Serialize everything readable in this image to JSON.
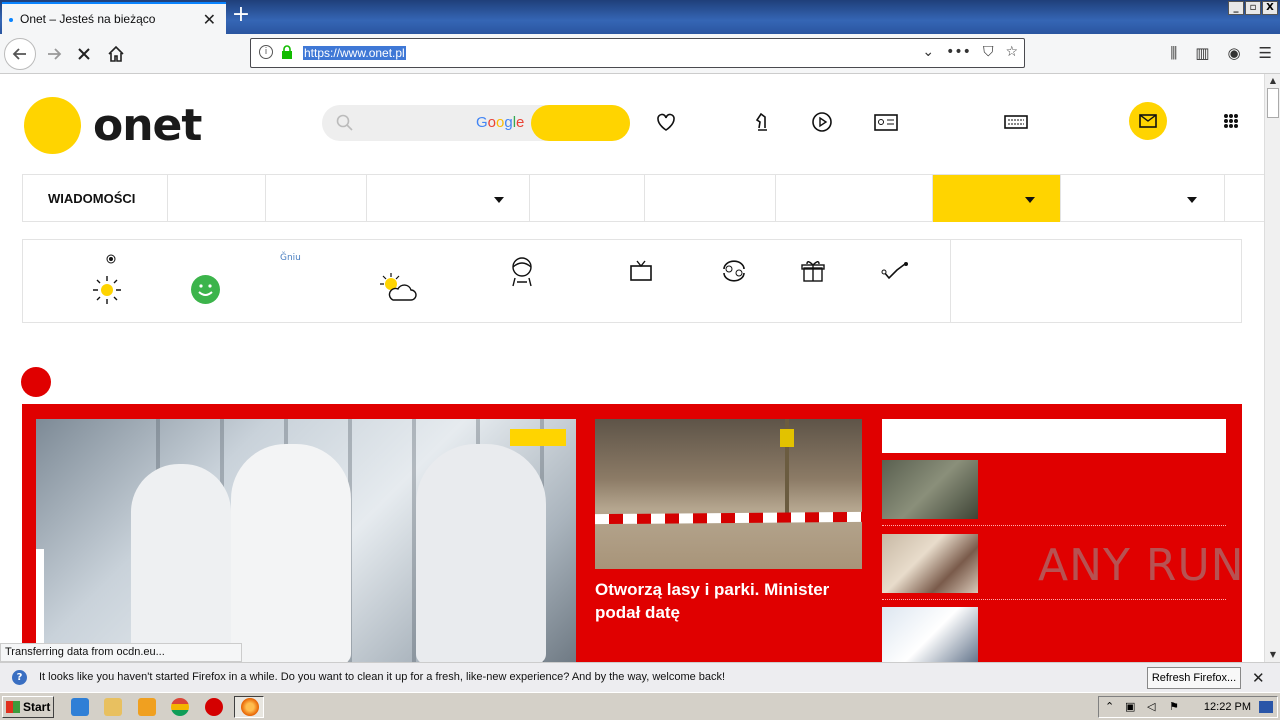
{
  "browser": {
    "tab_title": "Onet – Jesteś na bieżąco",
    "tab_close": "✕",
    "new_tab": "+",
    "url": "https://www.onet.pl",
    "window_buttons": [
      "_",
      "▫",
      "X"
    ]
  },
  "site": {
    "logo_text": "onet",
    "search_brand": "Google",
    "menu_first_item": "WIADOMOŚCI",
    "weather_small_text": "Ğniu",
    "featured_title": "Otworzą lasy i parki. Minister podał datę"
  },
  "status": {
    "transfer_message": "Transferring data from ocdn.eu..."
  },
  "notification": {
    "message": "It looks like you haven't started Firefox in a while. Do you want to clean it up for a fresh, like-new experience? And by the way, welcome back!",
    "refresh_button": "Refresh Firefox...",
    "close": "✕"
  },
  "taskbar": {
    "start_label": "Start",
    "clock": "12:22 PM"
  },
  "watermark": "ANY RUN",
  "colors": {
    "brand_yellow": "#ffd400",
    "news_red": "#e00000",
    "link_blue": "#0a84ff"
  }
}
